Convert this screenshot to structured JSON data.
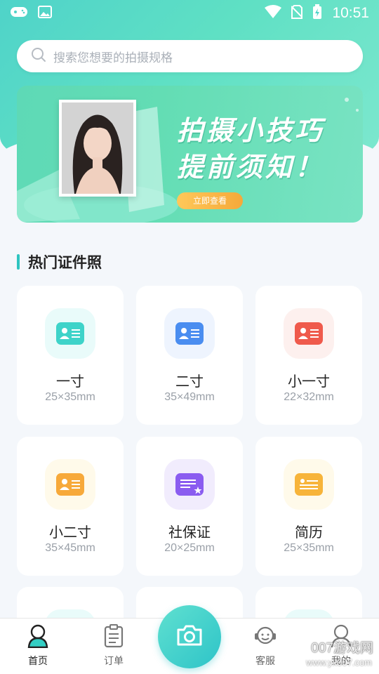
{
  "status_bar": {
    "time": "10:51"
  },
  "search": {
    "placeholder": "搜索您想要的拍摄规格"
  },
  "banner": {
    "line1": "拍摄小技巧",
    "line2": "提前须知！",
    "button": "立即查看"
  },
  "section": {
    "title": "热门证件照"
  },
  "cards": [
    {
      "name": "一寸",
      "size": "25×35mm",
      "color": "#3ed3c9",
      "bg": "#e9fbfa"
    },
    {
      "name": "二寸",
      "size": "35×49mm",
      "color": "#4a8df0",
      "bg": "#eef4fe"
    },
    {
      "name": "小一寸",
      "size": "22×32mm",
      "color": "#ef5a4c",
      "bg": "#fdf0ee"
    },
    {
      "name": "小二寸",
      "size": "35×45mm",
      "color": "#f7a93a",
      "bg": "#fffaea"
    },
    {
      "name": "社保证",
      "size": "20×25mm",
      "color": "#8a5cf0",
      "bg": "#f1ecfd"
    },
    {
      "name": "简历",
      "size": "25×35mm",
      "color": "#f7b43a",
      "bg": "#fffaea"
    }
  ],
  "nav": {
    "home": "首页",
    "orders": "订单",
    "service": "客服",
    "mine": "我的"
  },
  "watermark": {
    "line1": "007游戏网",
    "line2": "www.yx007.com"
  }
}
